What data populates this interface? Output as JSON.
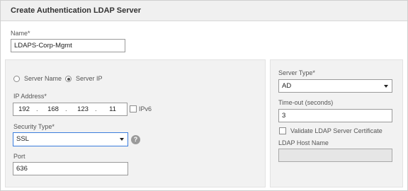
{
  "dialog": {
    "title": "Create Authentication LDAP Server"
  },
  "name_field": {
    "label": "Name*",
    "value": "LDAPS-Corp-Mgmt"
  },
  "address_mode": {
    "server_name_label": "Server Name",
    "server_ip_label": "Server IP",
    "selected": "Server IP"
  },
  "ip_address": {
    "label": "IP Address*",
    "octets": [
      "192",
      "168",
      "123",
      "11"
    ],
    "separator": ".",
    "ipv6_label": "IPv6"
  },
  "security_type": {
    "label": "Security Type*",
    "value": "SSL",
    "help": "?"
  },
  "port": {
    "label": "Port",
    "value": "636"
  },
  "server_type": {
    "label": "Server Type*",
    "value": "AD"
  },
  "timeout": {
    "label": "Time-out (seconds)",
    "value": "3"
  },
  "validate_cert": {
    "label": "Validate LDAP Server Certificate"
  },
  "ldap_host_name": {
    "label": "LDAP Host Name",
    "value": ""
  },
  "colors": {
    "panel_bg": "#f2f2f2",
    "title_bg": "#f0f0f0",
    "focus_border": "#3b7ddd",
    "disabled_input": "#e6e6e6"
  }
}
